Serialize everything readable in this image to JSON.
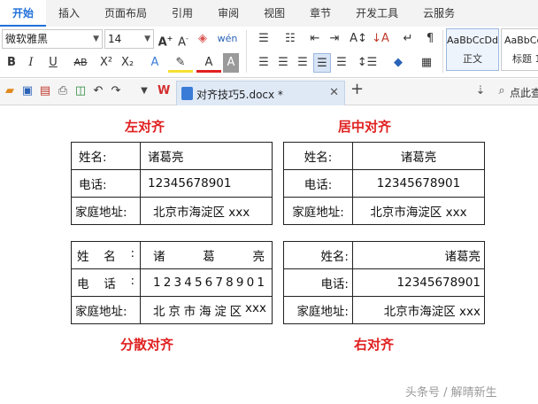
{
  "menu": {
    "tabs": [
      "开始",
      "插入",
      "页面布局",
      "引用",
      "审阅",
      "视图",
      "章节",
      "开发工具",
      "云服务"
    ]
  },
  "ribbon": {
    "font_name": "微软雅黑",
    "font_size": "14",
    "styles": [
      {
        "sample": "AaBbCcDd",
        "label": "正文"
      },
      {
        "sample": "AaBbCc",
        "label": "标题 1"
      }
    ]
  },
  "quickbar": {
    "doc_title": "对齐技巧5.docx *",
    "find_label": "点此查"
  },
  "labels": {
    "left": "左对齐",
    "center": "居中对齐",
    "distributed": "分散对齐",
    "right": "右对齐"
  },
  "record": {
    "name_label": "姓名:",
    "name_value": "诸葛亮",
    "phone_label": "电话:",
    "phone_value": "12345678901",
    "address_label": "家庭地址:",
    "address_value": "北京市海淀区 xxx"
  },
  "distributed": {
    "name_label_chars": [
      "姓",
      "名",
      ":"
    ],
    "name_value_chars": [
      "诸",
      "葛",
      "亮"
    ],
    "phone_label_chars": [
      "电",
      "话",
      ":"
    ],
    "phone_value_chars": [
      "1",
      "2",
      "3",
      "4",
      "5",
      "6",
      "7",
      "8",
      "9",
      "0",
      "1"
    ],
    "address_label": "家庭地址:",
    "address_value_chars": [
      "北",
      "京",
      "市",
      "海",
      "淀",
      "区",
      "xxx"
    ]
  },
  "watermark": "头条号 / 解晴新生"
}
